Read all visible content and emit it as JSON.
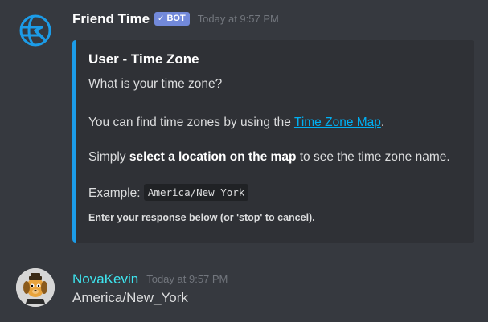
{
  "bot_message": {
    "author": "Friend Time",
    "bot_tag": "BOT",
    "timestamp": "Today at 9:57 PM",
    "embed": {
      "title": "User - Time Zone",
      "question": "What is your time zone?",
      "find_prefix": "You can find time zones by using the ",
      "find_link": "Time Zone Map",
      "find_suffix": ".",
      "simply_prefix": "Simply ",
      "simply_bold": "select a location on the map",
      "simply_suffix": " to see the time zone name.",
      "example_label": "Example: ",
      "example_code": "America/New_York",
      "footer": "Enter your response below (or 'stop' to cancel)."
    }
  },
  "user_message": {
    "author": "NovaKevin",
    "timestamp": "Today at 9:57 PM",
    "content": "America/New_York"
  },
  "colors": {
    "background": "#36393f",
    "embed_background": "#2f3136",
    "embed_accent": "#1c9ce8",
    "bot_tag": "#7289da",
    "user_name": "#3ee6f0",
    "link": "#00b0f4"
  }
}
